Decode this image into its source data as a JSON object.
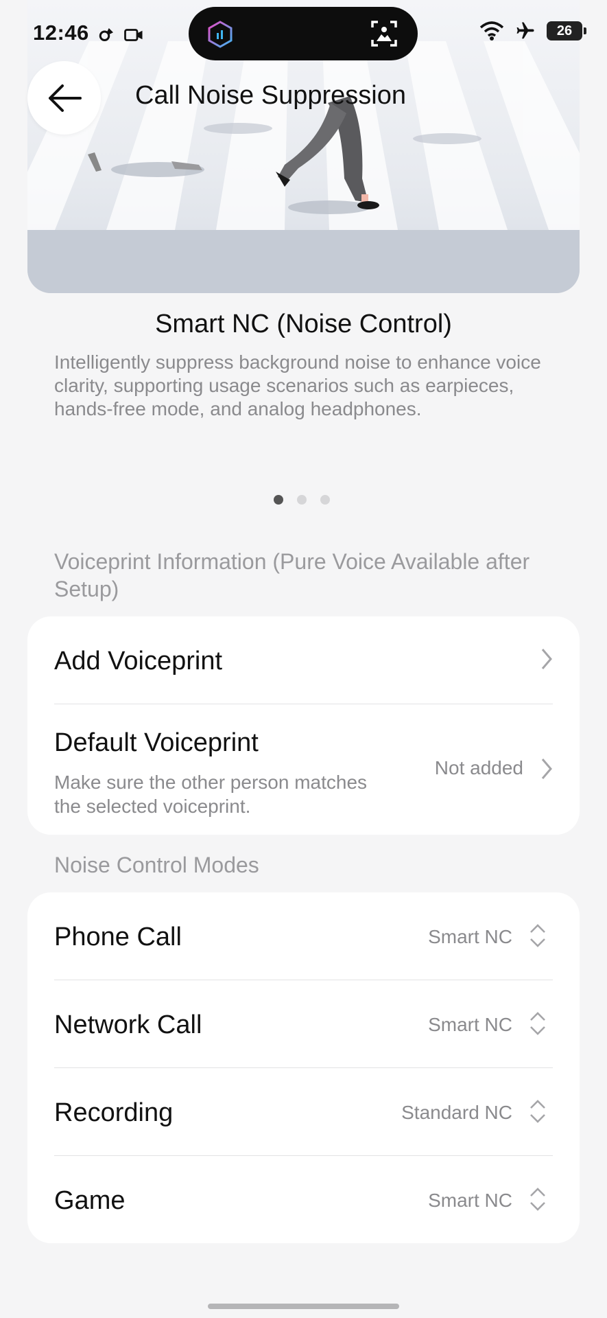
{
  "status_bar": {
    "time": "12:46",
    "battery": "26"
  },
  "header": {
    "title": "Call Noise Suppression",
    "back_icon": "arrow-left-icon"
  },
  "feature": {
    "title": "Smart NC (Noise Control)",
    "description": "Intelligently suppress background noise to enhance voice clarity, supporting usage scenarios such as earpieces, hands-free mode, and analog headphones.",
    "pages": 3,
    "active_page": 1
  },
  "voiceprint_section": {
    "header": "Voiceprint Information (Pure Voice Available after Setup)",
    "items": [
      {
        "label": "Add Voiceprint"
      },
      {
        "label": "Default Voiceprint",
        "sublabel": "Make sure the other person matches the selected voiceprint.",
        "value": "Not added"
      }
    ]
  },
  "modes_section": {
    "header": "Noise Control Modes",
    "items": [
      {
        "label": "Phone Call",
        "value": "Smart NC"
      },
      {
        "label": "Network Call",
        "value": "Smart NC"
      },
      {
        "label": "Recording",
        "value": "Standard NC"
      },
      {
        "label": "Game",
        "value": "Smart NC"
      }
    ]
  },
  "colors": {
    "background": "#f5f5f6",
    "card": "#ffffff",
    "secondary_text": "#8a8a8d"
  }
}
